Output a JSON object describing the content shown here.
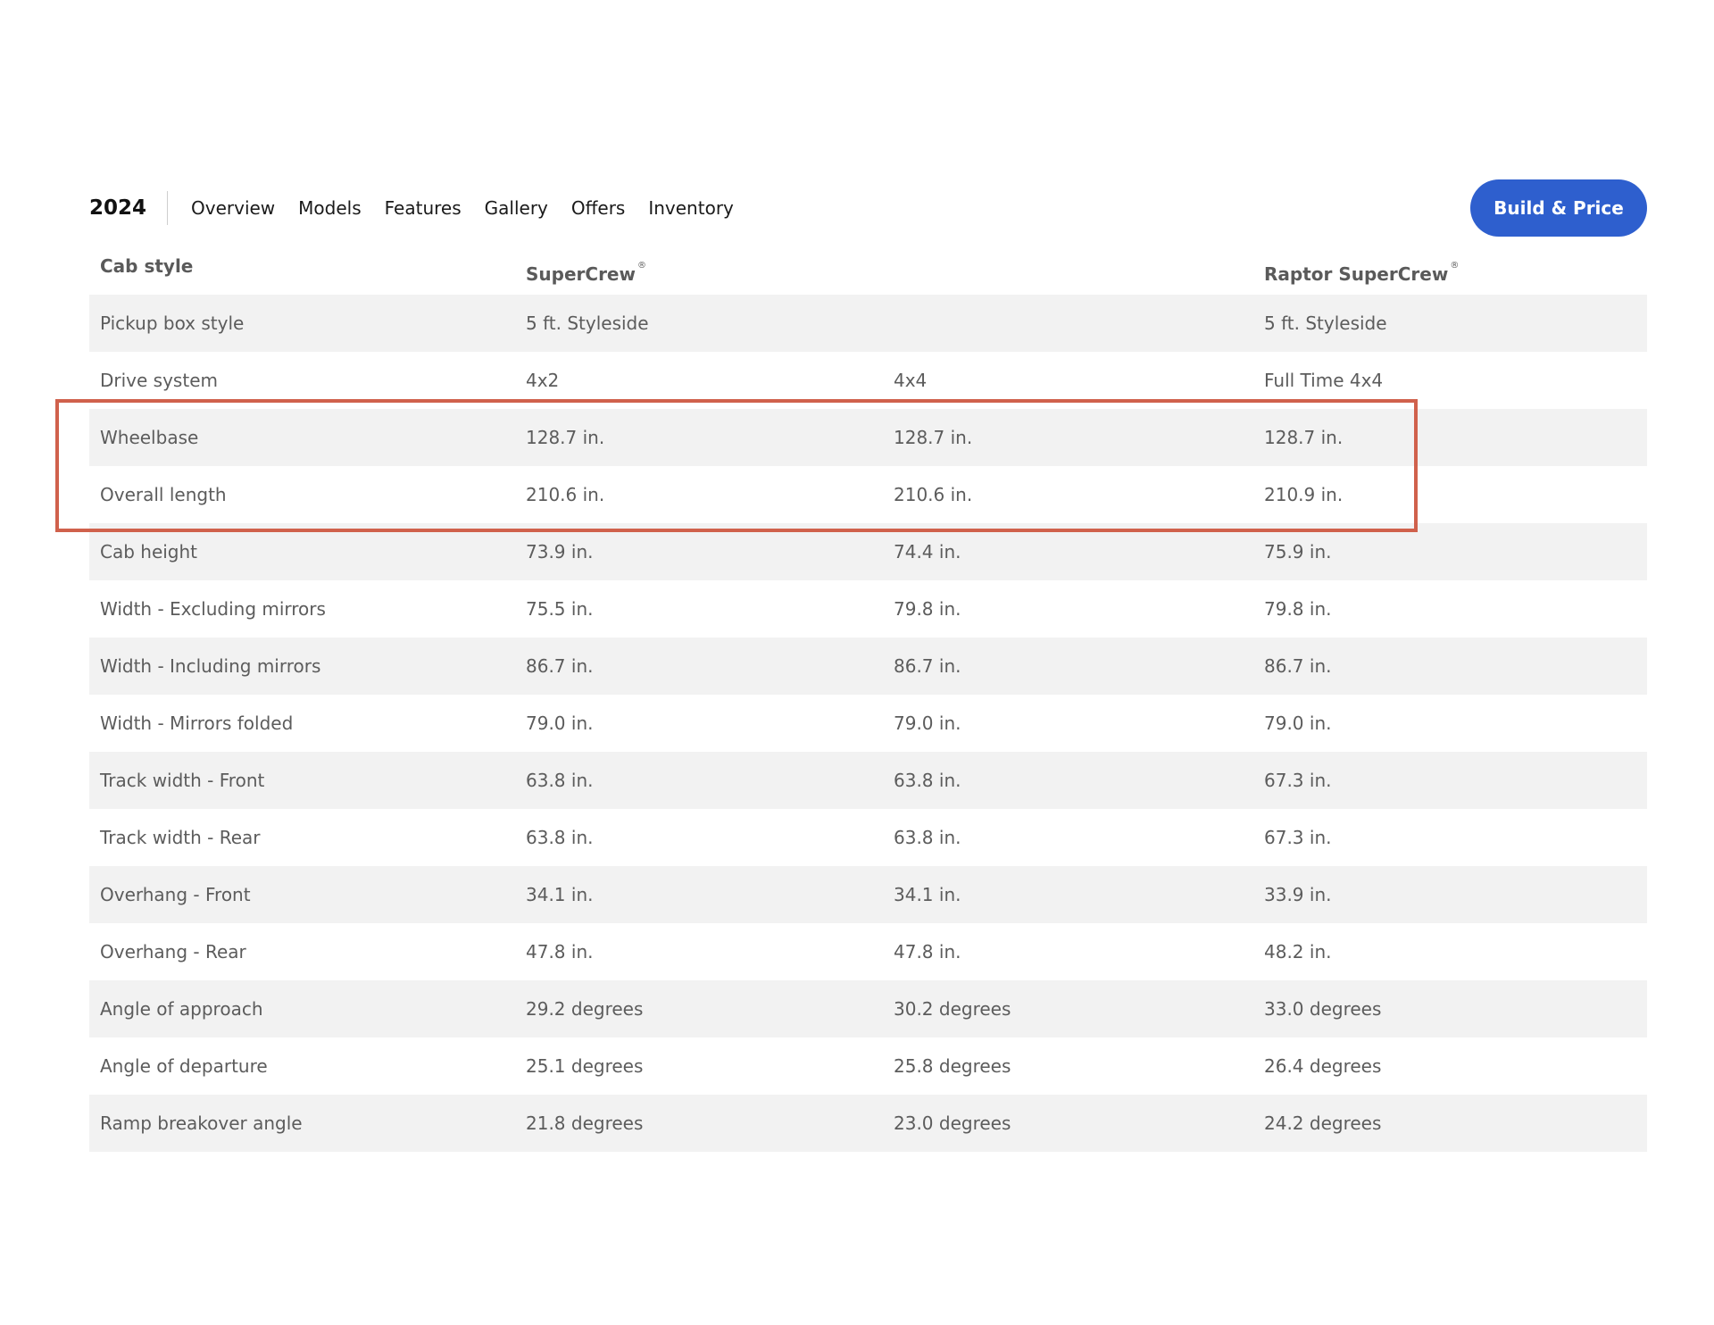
{
  "nav": {
    "year": "2024",
    "links": [
      "Overview",
      "Models",
      "Features",
      "Gallery",
      "Offers",
      "Inventory"
    ],
    "build_button": "Build & Price"
  },
  "table": {
    "header": {
      "label": "Cab style",
      "col1": "SuperCrew",
      "col2": "",
      "col3": "Raptor SuperCrew",
      "registered_mark": "®"
    },
    "rows": [
      {
        "label": "Pickup box style",
        "values": [
          "5 ft. Styleside",
          "",
          "5 ft. Styleside"
        ]
      },
      {
        "label": "Drive system",
        "values": [
          "4x2",
          "4x4",
          "Full Time 4x4"
        ]
      },
      {
        "label": "Wheelbase",
        "values": [
          "128.7 in.",
          "128.7 in.",
          "128.7 in."
        ]
      },
      {
        "label": "Overall length",
        "values": [
          "210.6 in.",
          "210.6 in.",
          "210.9 in."
        ]
      },
      {
        "label": "Cab height",
        "values": [
          "73.9 in.",
          "74.4 in.",
          "75.9 in."
        ]
      },
      {
        "label": "Width - Excluding mirrors",
        "values": [
          "75.5 in.",
          "79.8 in.",
          "79.8 in."
        ]
      },
      {
        "label": "Width - Including mirrors",
        "values": [
          "86.7 in.",
          "86.7 in.",
          "86.7 in."
        ]
      },
      {
        "label": "Width - Mirrors folded",
        "values": [
          "79.0 in.",
          "79.0 in.",
          "79.0 in."
        ]
      },
      {
        "label": "Track width - Front",
        "values": [
          "63.8 in.",
          "63.8 in.",
          "67.3 in."
        ]
      },
      {
        "label": "Track width - Rear",
        "values": [
          "63.8 in.",
          "63.8 in.",
          "67.3 in."
        ]
      },
      {
        "label": "Overhang - Front",
        "values": [
          "34.1 in.",
          "34.1 in.",
          "33.9 in."
        ]
      },
      {
        "label": "Overhang - Rear",
        "values": [
          "47.8 in.",
          "47.8 in.",
          "48.2 in."
        ]
      },
      {
        "label": "Angle of approach",
        "values": [
          "29.2 degrees",
          "30.2 degrees",
          "33.0 degrees"
        ]
      },
      {
        "label": "Angle of departure",
        "values": [
          "25.1 degrees",
          "25.8 degrees",
          "26.4 degrees"
        ]
      },
      {
        "label": "Ramp breakover angle",
        "values": [
          "21.8 degrees",
          "23.0 degrees",
          "24.2 degrees"
        ]
      }
    ]
  },
  "colors": {
    "button": "#2e5fce",
    "row_shade": "#f2f2f2",
    "highlight": "#d0614c"
  }
}
